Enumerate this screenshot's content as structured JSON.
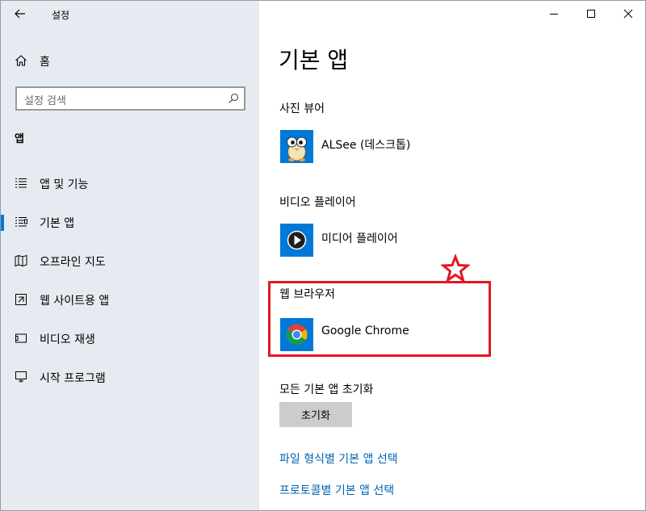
{
  "window": {
    "title": "설정",
    "controls": {
      "minimize": "minimize",
      "maximize": "maximize",
      "close": "close"
    }
  },
  "sidebar": {
    "home_label": "홈",
    "search_placeholder": "설정 검색",
    "section_title": "앱",
    "items": [
      {
        "label": "앱 및 기능",
        "icon": "apps-features-icon",
        "selected": false
      },
      {
        "label": "기본 앱",
        "icon": "default-apps-icon",
        "selected": true
      },
      {
        "label": "오프라인 지도",
        "icon": "offline-maps-icon",
        "selected": false
      },
      {
        "label": "웹 사이트용 앱",
        "icon": "apps-for-websites-icon",
        "selected": false
      },
      {
        "label": "비디오 재생",
        "icon": "video-playback-icon",
        "selected": false
      },
      {
        "label": "시작 프로그램",
        "icon": "startup-icon",
        "selected": false
      }
    ]
  },
  "main": {
    "title": "기본 앱",
    "categories": [
      {
        "label": "사진 뷰어",
        "app": "ALSee (데스크톱)",
        "icon": "alsee-app-icon"
      },
      {
        "label": "비디오 플레이어",
        "app": "미디어 플레이어",
        "icon": "media-player-app-icon"
      },
      {
        "label": "웹 브라우저",
        "app": "Google Chrome",
        "icon": "chrome-app-icon"
      }
    ],
    "reset_label": "모든 기본 앱 초기화",
    "reset_button": "초기화",
    "links": [
      "파일 형식별 기본 앱 선택",
      "프로토콜별 기본 앱 선택"
    ]
  },
  "colors": {
    "sidebar_bg": "#e6ebf1",
    "accent": "#0078d7",
    "link": "#0063b1",
    "annotation": "#e01923",
    "tile_bg": "#0078d7"
  }
}
